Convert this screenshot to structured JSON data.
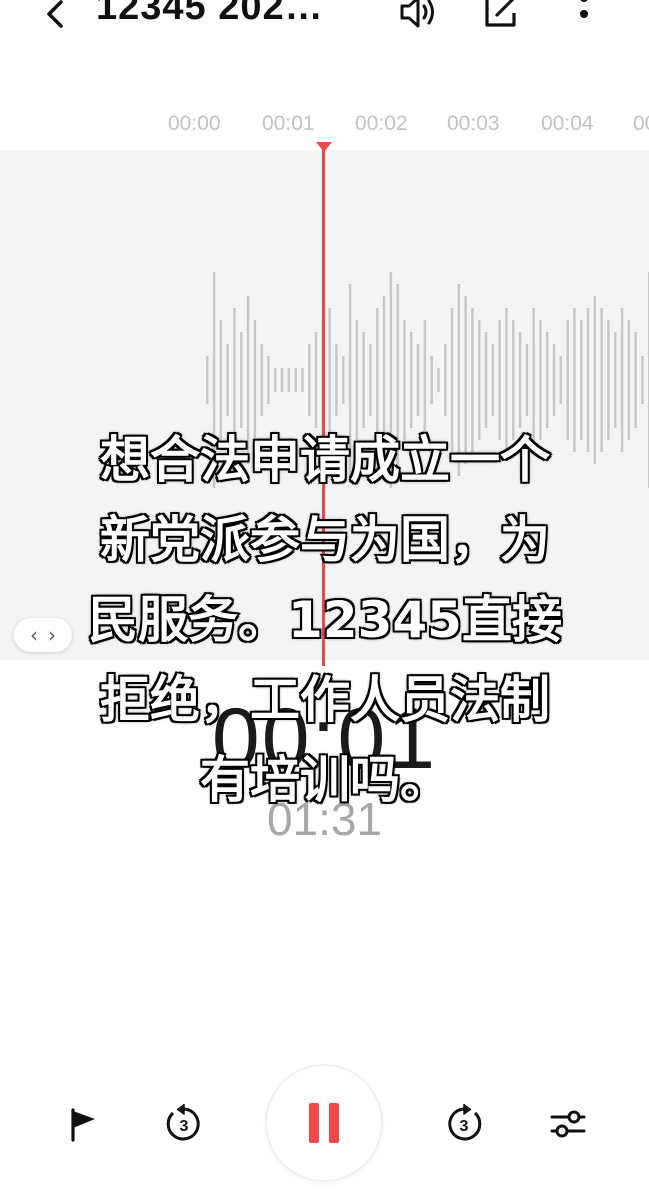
{
  "header": {
    "title": "12345 202…",
    "icons": [
      "chevron-left-icon",
      "speaker-icon",
      "edit-icon",
      "more-vertical-icon"
    ]
  },
  "timeline": {
    "ticks": [
      "00:00",
      "00:01",
      "00:02",
      "00:03",
      "00:04",
      "00"
    ]
  },
  "player": {
    "elapsed": "00:01",
    "duration": "01:31",
    "accent_color": "#f04848"
  },
  "subtitle": {
    "lines": [
      "想合法申请成立一个",
      "新党派参与为国，为",
      "民服务。12345直接",
      "拒绝，工作人员法制",
      "有培训吗。"
    ]
  },
  "controls": {
    "icons": [
      "flag-icon",
      "rewind-3-icon",
      "pause-icon",
      "forward-3-icon",
      "sliders-icon"
    ]
  }
}
